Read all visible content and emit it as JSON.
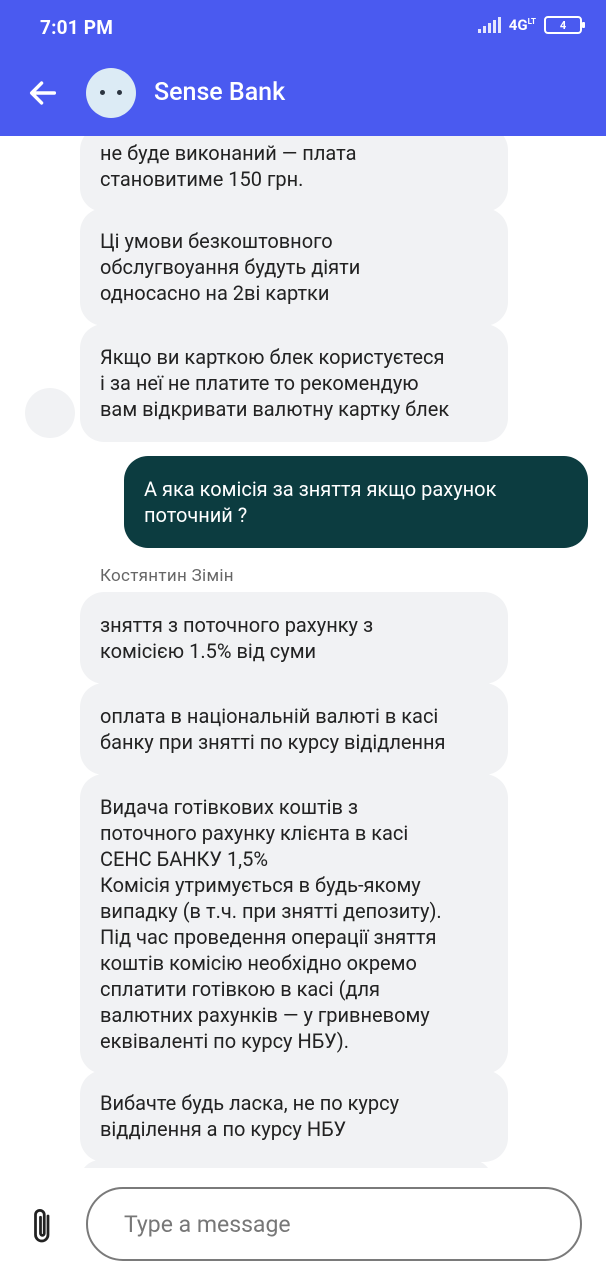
{
  "status_bar": {
    "time": "7:01 PM",
    "network": "4G",
    "network_suffix": "LT",
    "battery": "4"
  },
  "header": {
    "title": "Sense Bank",
    "icons": {
      "back": "arrow-left-icon",
      "avatar": "bot-face-icon"
    },
    "background_color": "#4a5af0"
  },
  "messages": [
    {
      "from": "bot",
      "text": "не буде виконаний — плата\nстановитиме 150 грн."
    },
    {
      "from": "bot",
      "text": "Ці умови безкоштовного\nобслугвоуання будуть діяти\nодносасно на 2ві картки"
    },
    {
      "from": "bot",
      "text": "Якщо ви карткою блек користуєтеся\nі  за неї не платите то рекомендую\nвам відкривати валютну картку блек"
    },
    {
      "from": "user",
      "text": "А яка комісія за зняття якщо рахунок\nпоточний ?"
    },
    {
      "from": "bot",
      "text": "зняття з поточного рахунку з\nкомісією 1.5% від суми"
    },
    {
      "from": "bot",
      "text": "оплата в національній валюті в касі\nбанку при знятті по курсу відідлення"
    },
    {
      "from": "bot",
      "text": "Видача готівкових коштів з\nпоточного рахунку клієнта в касі\nСЕНС БАНКУ 1,5%\nКомісія утримується в будь-якому\nвипадку (в т.ч. при знятті депозиту).\nПід час проведення операції зняття\nкоштів комісію необхідно окремо\nсплатити готівкою в касі (для\nвалютних рахунків — у гривневому\nеквіваленті по курсу НБУ)."
    },
    {
      "from": "bot",
      "text": "Вибачте будь ласка, не по курсу\nвідділення а по курсу НБУ"
    }
  ],
  "sender_label": "Костянтин Зімін",
  "composer": {
    "placeholder": "Type a message",
    "attach_icon": "paperclip-icon"
  },
  "colors": {
    "user_bubble": "#0c3c40",
    "bot_bubble": "#f1f2f4"
  }
}
